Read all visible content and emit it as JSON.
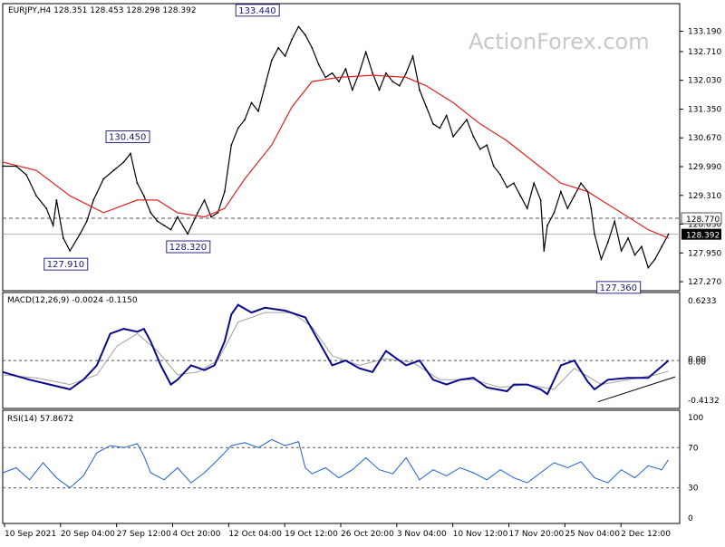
{
  "chart_data": {
    "type": "line",
    "watermark": "ActionForex.com",
    "colors": {
      "price": "#000000",
      "ma": "#e02020",
      "macd": "#0a0a8c",
      "macd_signal": "#a0a0a0",
      "rsi": "#1e5fd2",
      "level_line": "#505050",
      "label_box": "#2a2a8a",
      "current_box": "#000000"
    },
    "price": {
      "header": "EURJPY,H4  128.351 128.453 128.298 128.392",
      "ylim": [
        127.1,
        133.8
      ],
      "ticks": [
        "133.190",
        "132.710",
        "132.030",
        "131.350",
        "130.670",
        "129.990",
        "129.310",
        "128.630",
        "127.950",
        "127.270"
      ],
      "resistance": "128.770",
      "current": "128.392",
      "annotations": [
        {
          "text": "133.440",
          "value": 133.44,
          "x": 0.379
        },
        {
          "text": "130.450",
          "value": 130.45,
          "x": 0.186
        },
        {
          "text": "128.320",
          "value": 128.32,
          "x": 0.276
        },
        {
          "text": "127.910",
          "value": 127.91,
          "x": 0.094
        },
        {
          "text": "127.360",
          "value": 127.36,
          "x": 0.916
        }
      ],
      "close": [
        [
          0,
          130.0
        ],
        [
          0.02,
          130.0
        ],
        [
          0.035,
          129.8
        ],
        [
          0.05,
          129.3
        ],
        [
          0.065,
          129.0
        ],
        [
          0.075,
          128.6
        ],
        [
          0.08,
          129.2
        ],
        [
          0.09,
          128.3
        ],
        [
          0.1,
          128.0
        ],
        [
          0.115,
          128.4
        ],
        [
          0.125,
          128.7
        ],
        [
          0.135,
          129.2
        ],
        [
          0.15,
          129.7
        ],
        [
          0.165,
          129.9
        ],
        [
          0.18,
          130.1
        ],
        [
          0.19,
          130.3
        ],
        [
          0.2,
          129.6
        ],
        [
          0.21,
          129.3
        ],
        [
          0.22,
          128.9
        ],
        [
          0.23,
          128.7
        ],
        [
          0.24,
          128.6
        ],
        [
          0.25,
          128.5
        ],
        [
          0.26,
          128.8
        ],
        [
          0.275,
          128.4
        ],
        [
          0.29,
          128.9
        ],
        [
          0.3,
          129.2
        ],
        [
          0.31,
          128.8
        ],
        [
          0.32,
          128.9
        ],
        [
          0.33,
          129.4
        ],
        [
          0.34,
          130.5
        ],
        [
          0.35,
          130.9
        ],
        [
          0.36,
          131.1
        ],
        [
          0.37,
          131.5
        ],
        [
          0.38,
          131.3
        ],
        [
          0.39,
          131.9
        ],
        [
          0.4,
          132.5
        ],
        [
          0.41,
          132.8
        ],
        [
          0.42,
          132.6
        ],
        [
          0.43,
          133.0
        ],
        [
          0.44,
          133.3
        ],
        [
          0.45,
          133.1
        ],
        [
          0.46,
          132.8
        ],
        [
          0.47,
          132.4
        ],
        [
          0.48,
          132.1
        ],
        [
          0.49,
          132.2
        ],
        [
          0.5,
          132.0
        ],
        [
          0.51,
          132.3
        ],
        [
          0.52,
          131.8
        ],
        [
          0.53,
          132.2
        ],
        [
          0.54,
          132.7
        ],
        [
          0.55,
          132.2
        ],
        [
          0.56,
          131.8
        ],
        [
          0.57,
          132.2
        ],
        [
          0.58,
          132.0
        ],
        [
          0.59,
          131.9
        ],
        [
          0.6,
          132.2
        ],
        [
          0.61,
          132.6
        ],
        [
          0.62,
          131.8
        ],
        [
          0.63,
          131.4
        ],
        [
          0.64,
          131.0
        ],
        [
          0.65,
          130.9
        ],
        [
          0.66,
          131.2
        ],
        [
          0.67,
          130.7
        ],
        [
          0.68,
          130.9
        ],
        [
          0.69,
          131.1
        ],
        [
          0.7,
          130.7
        ],
        [
          0.71,
          130.4
        ],
        [
          0.72,
          130.5
        ],
        [
          0.73,
          130.0
        ],
        [
          0.74,
          129.8
        ],
        [
          0.75,
          129.5
        ],
        [
          0.76,
          129.6
        ],
        [
          0.77,
          129.3
        ],
        [
          0.78,
          129.0
        ],
        [
          0.79,
          129.6
        ],
        [
          0.8,
          129.2
        ],
        [
          0.805,
          128.0
        ],
        [
          0.81,
          128.6
        ],
        [
          0.82,
          128.9
        ],
        [
          0.83,
          129.4
        ],
        [
          0.84,
          129.0
        ],
        [
          0.85,
          129.3
        ],
        [
          0.86,
          129.6
        ],
        [
          0.87,
          129.4
        ],
        [
          0.875,
          129.0
        ],
        [
          0.88,
          128.4
        ],
        [
          0.89,
          127.8
        ],
        [
          0.9,
          128.2
        ],
        [
          0.91,
          128.7
        ],
        [
          0.92,
          128.0
        ],
        [
          0.93,
          128.3
        ],
        [
          0.94,
          127.9
        ],
        [
          0.95,
          128.1
        ],
        [
          0.96,
          127.6
        ],
        [
          0.97,
          127.8
        ],
        [
          0.98,
          128.1
        ],
        [
          0.99,
          128.392
        ]
      ],
      "ma": [
        [
          0,
          130.1
        ],
        [
          0.05,
          129.9
        ],
        [
          0.1,
          129.3
        ],
        [
          0.15,
          128.9
        ],
        [
          0.2,
          129.2
        ],
        [
          0.23,
          129.2
        ],
        [
          0.26,
          128.9
        ],
        [
          0.3,
          128.8
        ],
        [
          0.33,
          129.0
        ],
        [
          0.36,
          129.7
        ],
        [
          0.4,
          130.5
        ],
        [
          0.43,
          131.4
        ],
        [
          0.46,
          132.0
        ],
        [
          0.5,
          132.1
        ],
        [
          0.55,
          132.15
        ],
        [
          0.6,
          132.1
        ],
        [
          0.63,
          131.9
        ],
        [
          0.67,
          131.5
        ],
        [
          0.71,
          131.0
        ],
        [
          0.75,
          130.6
        ],
        [
          0.79,
          130.1
        ],
        [
          0.83,
          129.6
        ],
        [
          0.87,
          129.4
        ],
        [
          0.9,
          129.1
        ],
        [
          0.93,
          128.8
        ],
        [
          0.96,
          128.5
        ],
        [
          0.99,
          128.3
        ]
      ]
    },
    "macd": {
      "header": "MACD(12,26,9) -0.0024 -0.1150",
      "ylim": [
        -0.48,
        0.68
      ],
      "ticks": [
        "0.6233",
        "0.00",
        "0.00",
        "-0.4132"
      ],
      "main": [
        [
          0,
          -0.12
        ],
        [
          0.04,
          -0.2
        ],
        [
          0.07,
          -0.25
        ],
        [
          0.1,
          -0.3
        ],
        [
          0.12,
          -0.2
        ],
        [
          0.14,
          -0.05
        ],
        [
          0.16,
          0.28
        ],
        [
          0.18,
          0.33
        ],
        [
          0.2,
          0.3
        ],
        [
          0.21,
          0.33
        ],
        [
          0.22,
          0.2
        ],
        [
          0.235,
          -0.05
        ],
        [
          0.25,
          -0.25
        ],
        [
          0.26,
          -0.2
        ],
        [
          0.28,
          -0.05
        ],
        [
          0.3,
          -0.1
        ],
        [
          0.315,
          -0.05
        ],
        [
          0.33,
          0.2
        ],
        [
          0.34,
          0.48
        ],
        [
          0.35,
          0.58
        ],
        [
          0.37,
          0.5
        ],
        [
          0.39,
          0.55
        ],
        [
          0.42,
          0.52
        ],
        [
          0.45,
          0.45
        ],
        [
          0.47,
          0.2
        ],
        [
          0.49,
          -0.05
        ],
        [
          0.51,
          0.0
        ],
        [
          0.53,
          -0.08
        ],
        [
          0.55,
          -0.12
        ],
        [
          0.57,
          0.1
        ],
        [
          0.6,
          -0.05
        ],
        [
          0.62,
          0.0
        ],
        [
          0.64,
          -0.2
        ],
        [
          0.66,
          -0.25
        ],
        [
          0.68,
          -0.2
        ],
        [
          0.7,
          -0.18
        ],
        [
          0.72,
          -0.28
        ],
        [
          0.75,
          -0.32
        ],
        [
          0.76,
          -0.25
        ],
        [
          0.78,
          -0.25
        ],
        [
          0.8,
          -0.3
        ],
        [
          0.81,
          -0.35
        ],
        [
          0.83,
          -0.05
        ],
        [
          0.85,
          0.0
        ],
        [
          0.87,
          -0.22
        ],
        [
          0.88,
          -0.3
        ],
        [
          0.9,
          -0.2
        ],
        [
          0.93,
          -0.18
        ],
        [
          0.96,
          -0.18
        ],
        [
          0.99,
          0.0
        ]
      ],
      "signal": [
        [
          0,
          -0.15
        ],
        [
          0.05,
          -0.18
        ],
        [
          0.1,
          -0.25
        ],
        [
          0.14,
          -0.15
        ],
        [
          0.17,
          0.15
        ],
        [
          0.2,
          0.28
        ],
        [
          0.23,
          0.1
        ],
        [
          0.26,
          -0.15
        ],
        [
          0.29,
          -0.12
        ],
        [
          0.32,
          0.0
        ],
        [
          0.35,
          0.4
        ],
        [
          0.39,
          0.5
        ],
        [
          0.43,
          0.5
        ],
        [
          0.46,
          0.35
        ],
        [
          0.49,
          0.05
        ],
        [
          0.53,
          -0.05
        ],
        [
          0.57,
          0.02
        ],
        [
          0.61,
          -0.02
        ],
        [
          0.65,
          -0.2
        ],
        [
          0.7,
          -0.2
        ],
        [
          0.74,
          -0.28
        ],
        [
          0.78,
          -0.25
        ],
        [
          0.82,
          -0.3
        ],
        [
          0.85,
          -0.08
        ],
        [
          0.89,
          -0.25
        ],
        [
          0.93,
          -0.2
        ],
        [
          0.97,
          -0.15
        ],
        [
          0.99,
          -0.11
        ]
      ],
      "trendline": [
        [
          0.885,
          -0.43
        ],
        [
          1.0,
          -0.17
        ]
      ]
    },
    "rsi": {
      "header": "RSI(14) 57.8672",
      "ylim": [
        0,
        100
      ],
      "ticks": [
        "100",
        "70",
        "30",
        "0"
      ],
      "levels": [
        70,
        30
      ],
      "values": [
        [
          0,
          45
        ],
        [
          0.02,
          50
        ],
        [
          0.04,
          38
        ],
        [
          0.06,
          55
        ],
        [
          0.08,
          40
        ],
        [
          0.1,
          30
        ],
        [
          0.12,
          42
        ],
        [
          0.14,
          65
        ],
        [
          0.16,
          72
        ],
        [
          0.18,
          70
        ],
        [
          0.2,
          74
        ],
        [
          0.21,
          62
        ],
        [
          0.22,
          45
        ],
        [
          0.24,
          38
        ],
        [
          0.26,
          50
        ],
        [
          0.28,
          35
        ],
        [
          0.3,
          45
        ],
        [
          0.32,
          58
        ],
        [
          0.34,
          72
        ],
        [
          0.36,
          75
        ],
        [
          0.38,
          70
        ],
        [
          0.4,
          78
        ],
        [
          0.42,
          72
        ],
        [
          0.44,
          76
        ],
        [
          0.45,
          50
        ],
        [
          0.46,
          44
        ],
        [
          0.48,
          50
        ],
        [
          0.5,
          40
        ],
        [
          0.52,
          48
        ],
        [
          0.54,
          60
        ],
        [
          0.56,
          48
        ],
        [
          0.58,
          44
        ],
        [
          0.6,
          60
        ],
        [
          0.62,
          38
        ],
        [
          0.64,
          48
        ],
        [
          0.66,
          42
        ],
        [
          0.68,
          50
        ],
        [
          0.7,
          45
        ],
        [
          0.72,
          38
        ],
        [
          0.74,
          48
        ],
        [
          0.76,
          40
        ],
        [
          0.78,
          35
        ],
        [
          0.8,
          45
        ],
        [
          0.82,
          55
        ],
        [
          0.84,
          50
        ],
        [
          0.86,
          56
        ],
        [
          0.88,
          40
        ],
        [
          0.9,
          35
        ],
        [
          0.92,
          48
        ],
        [
          0.94,
          40
        ],
        [
          0.96,
          52
        ],
        [
          0.98,
          48
        ],
        [
          0.99,
          58
        ]
      ]
    },
    "x_ticks": [
      "10 Sep 2021",
      "20 Sep 04:00",
      "27 Sep 12:00",
      "4 Oct 20:00",
      "12 Oct 04:00",
      "19 Oct 12:00",
      "26 Oct 20:00",
      "3 Nov 04:00",
      "10 Nov 12:00",
      "17 Nov 20:00",
      "25 Nov 04:00",
      "2 Dec 12:00"
    ]
  }
}
